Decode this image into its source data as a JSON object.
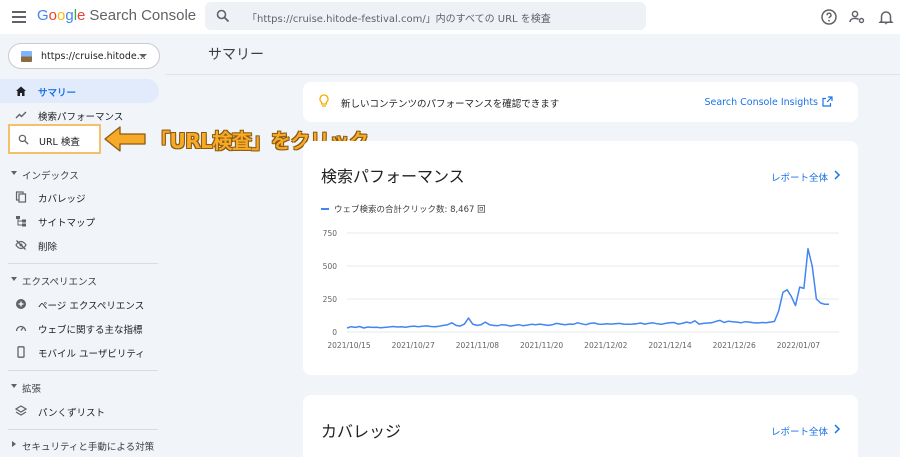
{
  "header": {
    "logo_letters": [
      "G",
      "o",
      "o",
      "g",
      "l",
      "e"
    ],
    "product": "Search Console",
    "search_placeholder": "「https://cruise.hitode-festival.com/」内のすべての URL を検査",
    "icons": [
      "help-icon",
      "manage-users-icon",
      "notifications-icon"
    ]
  },
  "sidebar": {
    "property": "https://cruise.hitode...",
    "items_top": [
      {
        "label": "サマリー",
        "icon": "home-icon",
        "active": true
      },
      {
        "label": "検索パフォーマンス",
        "icon": "trending-icon",
        "active": false
      }
    ],
    "url_inspection": {
      "label": "URL 検査",
      "icon": "search-icon"
    },
    "sections": [
      {
        "label": "インデックス",
        "items": [
          {
            "label": "カバレッジ",
            "icon": "copy-icon"
          },
          {
            "label": "サイトマップ",
            "icon": "sitemap-icon"
          },
          {
            "label": "削除",
            "icon": "visibility-off-icon"
          }
        ]
      },
      {
        "label": "エクスペリエンス",
        "items": [
          {
            "label": "ページ エクスペリエンス",
            "icon": "add-circle-icon"
          },
          {
            "label": "ウェブに関する主な指標",
            "icon": "speed-icon"
          },
          {
            "label": "モバイル ユーザビリティ",
            "icon": "smartphone-icon"
          }
        ]
      },
      {
        "label": "拡張",
        "items": [
          {
            "label": "パンくずリスト",
            "icon": "layers-icon"
          }
        ]
      },
      {
        "label": "セキュリティと手動による対策",
        "items": []
      }
    ]
  },
  "callout": {
    "text": "「URL検査」をクリック",
    "color": "#f7a928"
  },
  "main": {
    "title": "サマリー",
    "banner": {
      "text": "新しいコンテンツのパフォーマンスを確認できます",
      "link": "Search Console Insights"
    },
    "performance": {
      "title": "検索パフォーマンス",
      "report_link": "レポート全体",
      "legend": "ウェブ検索の合計クリック数: 8,467 回"
    },
    "coverage": {
      "title": "カバレッジ",
      "report_link": "レポート全体"
    }
  },
  "chart_data": {
    "type": "line",
    "series": [
      {
        "name": "ウェブ検索の合計クリック数: 8,467 回",
        "color": "#4285f4",
        "values": [
          30,
          40,
          35,
          42,
          30,
          38,
          35,
          36,
          32,
          35,
          38,
          42,
          38,
          40,
          36,
          42,
          45,
          40,
          44,
          46,
          42,
          40,
          44,
          50,
          55,
          70,
          50,
          45,
          60,
          105,
          60,
          50,
          55,
          75,
          55,
          50,
          48,
          55,
          52,
          45,
          50,
          55,
          48,
          52,
          58,
          55,
          60,
          55,
          50,
          55,
          65,
          60,
          55,
          60,
          58,
          70,
          62,
          55,
          65,
          68,
          60,
          58,
          62,
          60,
          62,
          65,
          60,
          58,
          60,
          62,
          68,
          60,
          65,
          70,
          62,
          58,
          65,
          70,
          72,
          60,
          65,
          75,
          68,
          85,
          60,
          65,
          68,
          70,
          80,
          88,
          72,
          82,
          78,
          75,
          70,
          78,
          75,
          70,
          68,
          72,
          70,
          75,
          80,
          160,
          300,
          320,
          270,
          200,
          340,
          330,
          630,
          500,
          250,
          220,
          210,
          210
        ]
      }
    ],
    "x_tick_labels": [
      "2021/10/15",
      "2021/10/27",
      "2021/11/08",
      "2021/11/20",
      "2021/12/02",
      "2021/12/14",
      "2021/12/26",
      "2022/01/07"
    ],
    "y_tick_labels": [
      "750",
      "500",
      "250",
      "0"
    ],
    "ylim": [
      0,
      750
    ],
    "grid": true
  }
}
